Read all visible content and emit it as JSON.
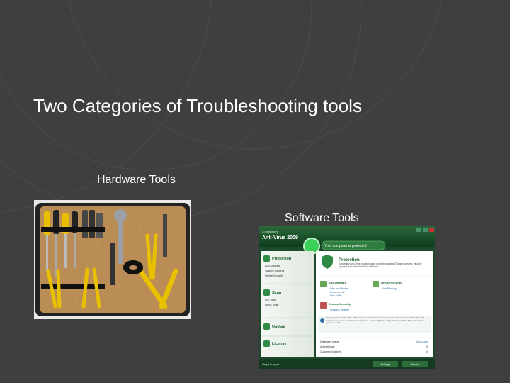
{
  "slide": {
    "title": "Two Categories of Troubleshooting tools",
    "hardware_label": "Hardware Tools",
    "software_label": "Software Tools"
  },
  "software_window": {
    "product_brand": "Kaspersky",
    "product_name": "Anti-Virus 2009",
    "status_banner": "Your computer is protected",
    "left_sections": [
      {
        "title": "Protection",
        "items": [
          "Anti-Malware",
          "System Security",
          "Online Security"
        ]
      },
      {
        "title": "Scan",
        "items": [
          "Full Scan",
          "Quick Scan"
        ]
      },
      {
        "title": "Update",
        "items": []
      },
      {
        "title": "License",
        "items": []
      }
    ],
    "main_title": "Protection",
    "main_desc": "Kaspersky Anti-Virus provides basic protection against Trojan programs, viruses, spyware and other malicious software",
    "modules": [
      {
        "name": "Anti-Malware",
        "items": [
          "Files and Memory",
          "E-mail and IM",
          "Web Traffic"
        ]
      },
      {
        "name": "Online Security",
        "items": [
          "Anti-Phishing"
        ]
      },
      {
        "name": "System Security",
        "items": [
          "Proactive Defense"
        ]
      }
    ],
    "info_note": "Kaspersky Internet Security 2009 contains a full-featured version of System Security and Online Security components as well as additional component - Content Filtering - they allow to perform full control of the system and data.",
    "stats": [
      {
        "label": "Databases status",
        "value": "Up-to-date"
      },
      {
        "label": "Active threats",
        "value": "0"
      },
      {
        "label": "Quarantined objects",
        "value": "0"
      }
    ],
    "footer_links": "Help | Support",
    "footer_buttons": [
      "Settings",
      "Reports"
    ]
  },
  "colors": {
    "background": "#3f3f3f",
    "text": "#ffffff",
    "kaspersky_green": "#1f8a3c"
  }
}
